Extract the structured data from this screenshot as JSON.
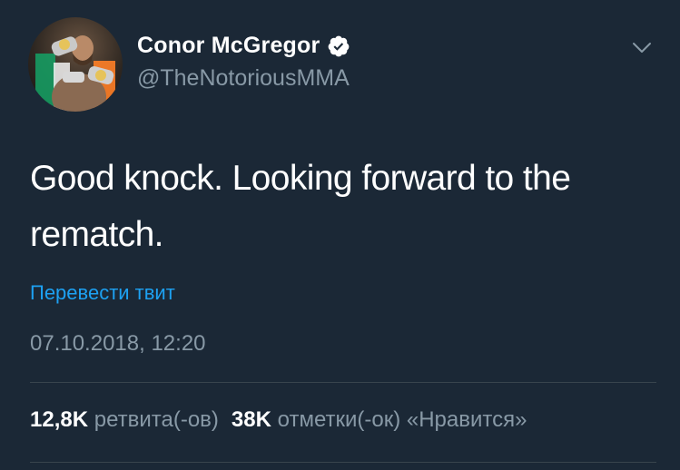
{
  "profile": {
    "display_name": "Conor McGregor",
    "handle": "@TheNotoriousMMA",
    "verified": true,
    "avatar_icon": "avatar-photo",
    "menu_icon": "chevron-down-icon"
  },
  "tweet": {
    "text": "Good knock. Looking forward to the rematch.",
    "translate_label": "Перевести твит",
    "timestamp": "07.10.2018, 12:20"
  },
  "stats": {
    "retweets_count": "12,8K",
    "retweets_label": "ретвита(-ов)",
    "likes_count": "38K",
    "likes_label": "отметки(-ок) «Нравится»"
  },
  "colors": {
    "background": "#1b2836",
    "text_primary": "#ffffff",
    "text_secondary": "#8899a6",
    "link": "#1da1f2",
    "divider": "#38444d"
  }
}
